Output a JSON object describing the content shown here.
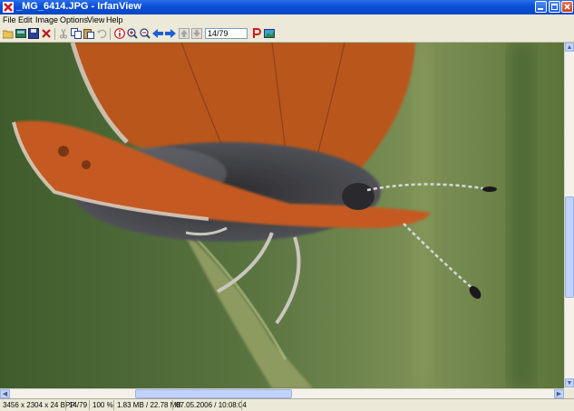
{
  "window": {
    "title": "_MG_6414.JPG - IrfanView"
  },
  "menu": {
    "file": "File",
    "edit": "Edit",
    "image": "Image",
    "options": "Options",
    "view": "View",
    "help": "Help"
  },
  "toolbar": {
    "page": "14/79"
  },
  "status": {
    "dimensions": "3456 x 2304 x 24 BPP",
    "index": "14/79",
    "zoom": "100 %",
    "size": "1.83 MB / 22.78 MB",
    "datetime": "07.05.2006 / 10:08:04"
  },
  "colors": {
    "title_bar": "#0a4fd6",
    "background": "#ece9d8",
    "butterfly_wing": "#c45a22"
  },
  "icons": [
    "open-folder-icon",
    "slideshow-icon",
    "save-icon",
    "delete-icon",
    "cut-icon",
    "copy-icon",
    "paste-icon",
    "undo-icon",
    "info-icon",
    "zoom-in-icon",
    "zoom-out-icon",
    "previous-icon",
    "next-icon",
    "first-icon",
    "last-icon",
    "print-icon",
    "paint-icon"
  ]
}
